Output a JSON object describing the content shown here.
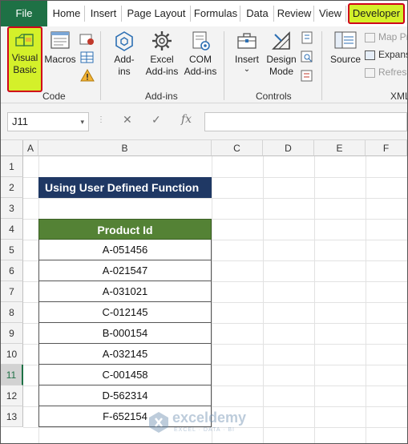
{
  "tabs": [
    "File",
    "Home",
    "Insert",
    "Page Layout",
    "Formulas",
    "Data",
    "Review",
    "View",
    "Developer"
  ],
  "ribbon": {
    "visual_basic": [
      "Visual",
      "Basic"
    ],
    "macros": "Macros",
    "addins": [
      "Add-",
      "ins"
    ],
    "excel_addins": [
      "Excel",
      "Add-ins"
    ],
    "com_addins": [
      "COM",
      "Add-ins"
    ],
    "insert": "Insert",
    "insert_arrow": "⌄",
    "design_mode": [
      "Design",
      "Mode"
    ],
    "source": "Source",
    "map_props": "Map Pro",
    "expansion": "Expans",
    "refresh": "Refresh",
    "groups": {
      "code": "Code",
      "addins": "Add-ins",
      "controls": "Controls",
      "xml": "XML"
    }
  },
  "formula_bar": {
    "name_box": "J11",
    "dropdown": "▾",
    "dots": "⋮",
    "cancel": "✕",
    "enter": "✓",
    "fx": "fx",
    "formula": ""
  },
  "columns": [
    "A",
    "B",
    "C",
    "D",
    "E",
    "F"
  ],
  "rows": [
    "1",
    "2",
    "3",
    "4",
    "5",
    "6",
    "7",
    "8",
    "9",
    "10",
    "11",
    "12",
    "13"
  ],
  "selected_row": "11",
  "sheet": {
    "title": "Using User Defined Function",
    "header": "Product Id",
    "product_ids": [
      "A-051456",
      "A-021547",
      "A-031021",
      "C-012145",
      "B-000154",
      "A-032145",
      "C-001458",
      "D-562314",
      "F-652154"
    ]
  },
  "watermark": {
    "name": "exceldemy",
    "tagline": "EXCEL · DATA · BI"
  },
  "colors": {
    "file_tab": "#1e7145",
    "highlight": "#d4f02a",
    "highlight_border": "#d0021b",
    "title_fill": "#1f3864",
    "header_fill": "#548235"
  }
}
